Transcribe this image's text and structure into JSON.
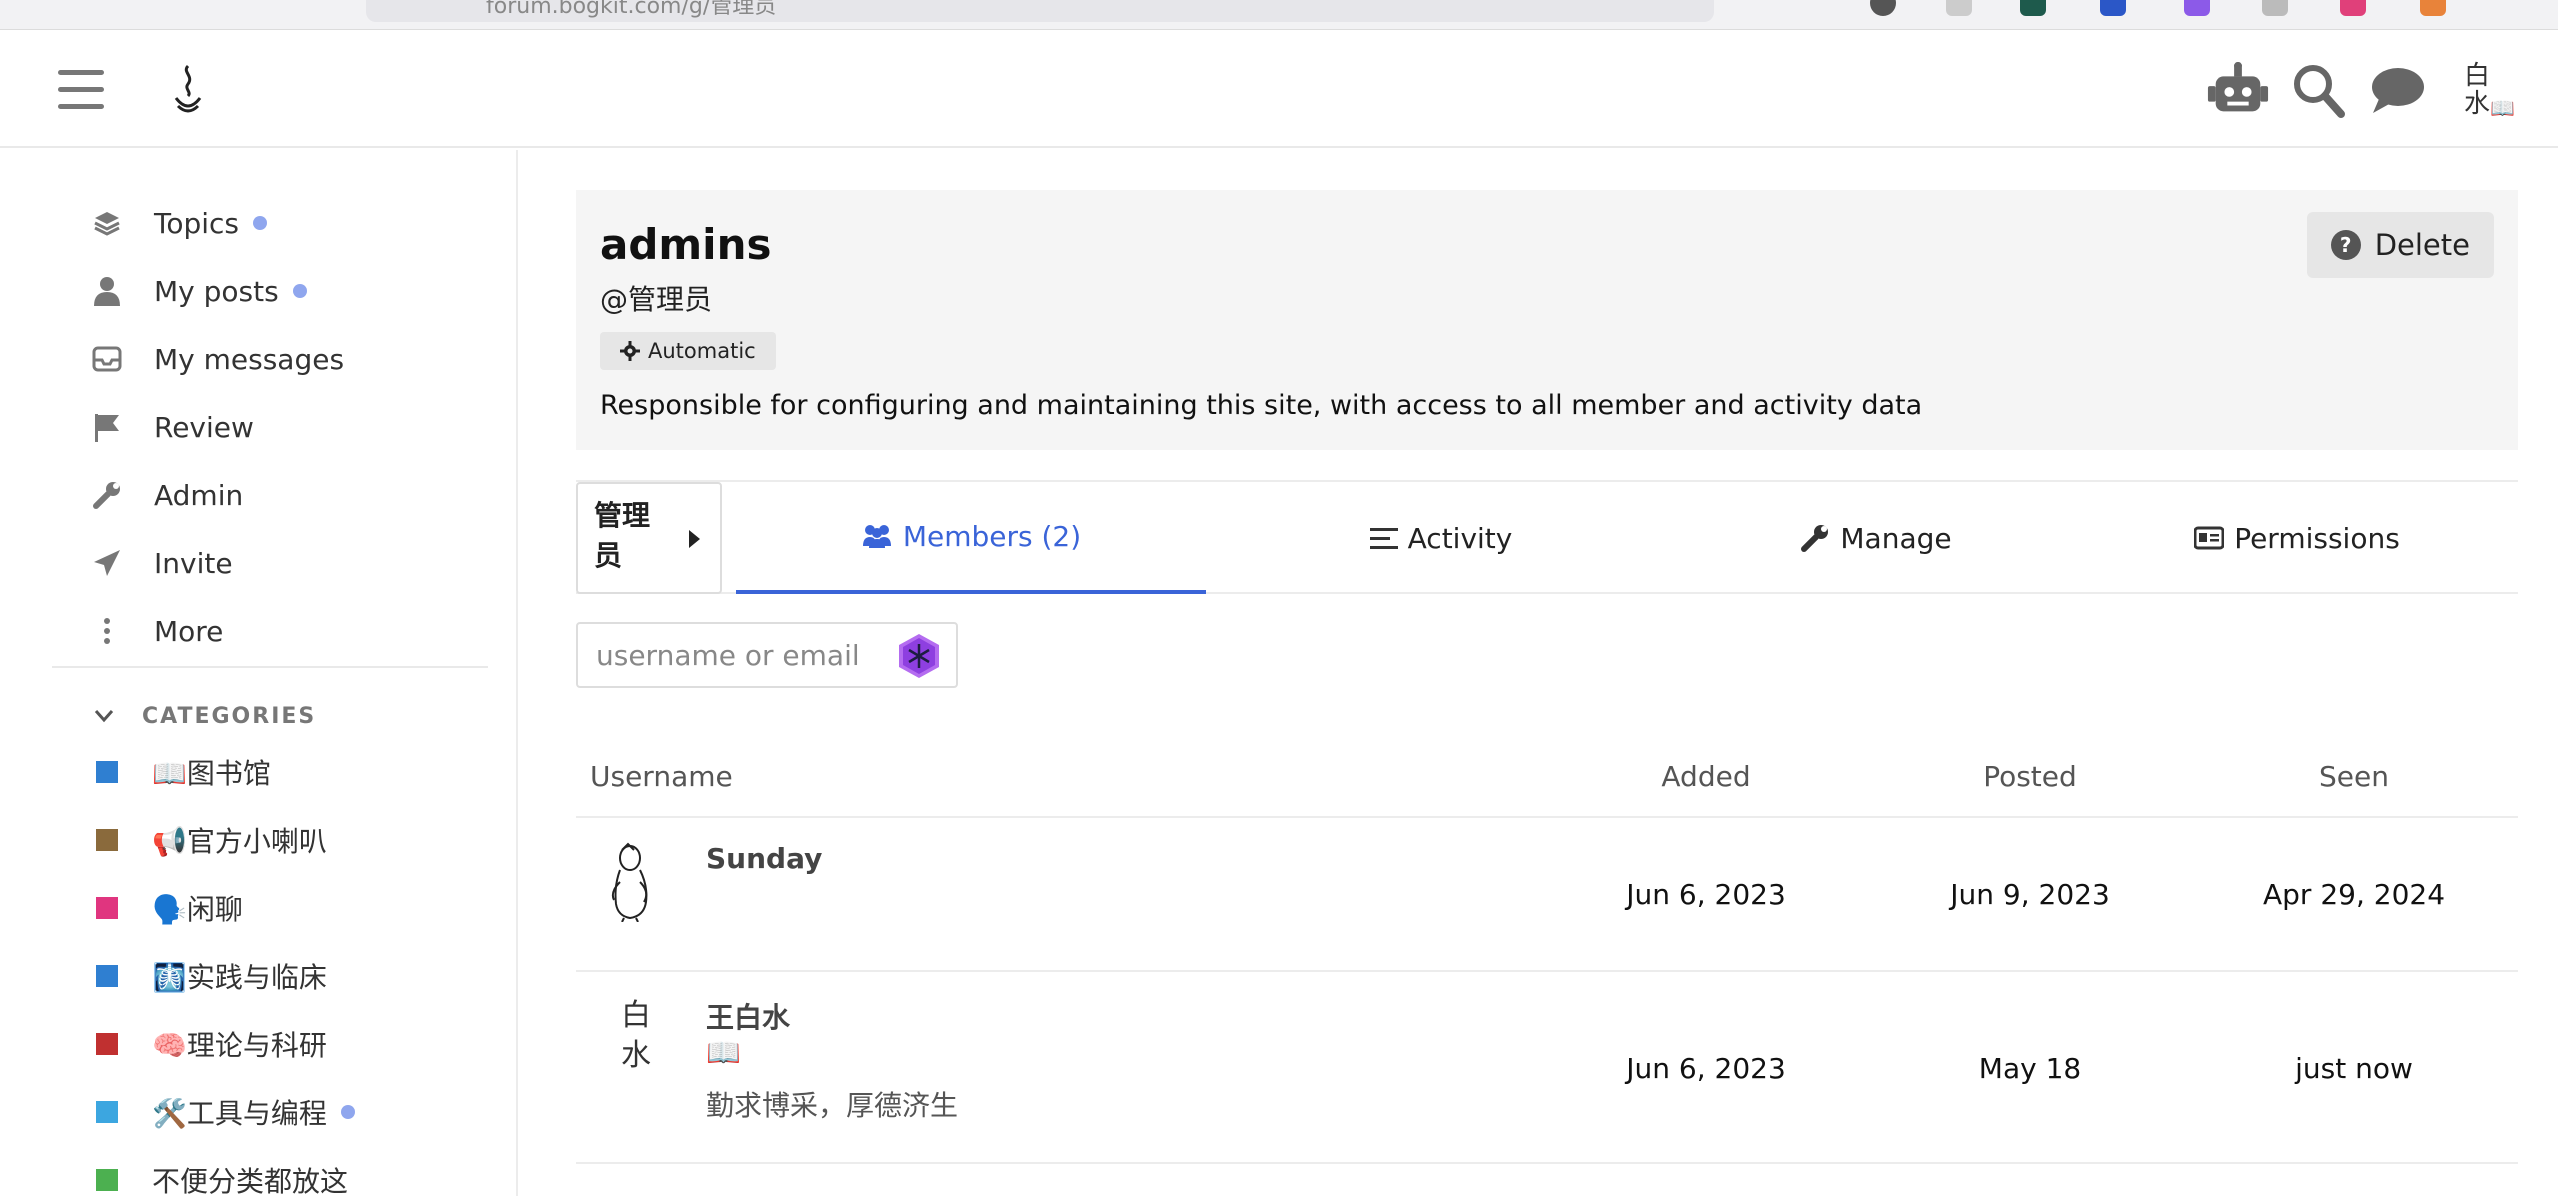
{
  "browser": {
    "url": "forum.bogkit.com/g/管理员"
  },
  "header": {
    "menu_icon": "hamburger-icon",
    "logo_icon": "incense-logo",
    "icons": [
      "robot-icon",
      "search-icon",
      "chat-icon"
    ],
    "avatar_text": "白水📖"
  },
  "sidebar": {
    "nav": [
      {
        "label": "Topics",
        "icon": "layers-icon",
        "unread": true
      },
      {
        "label": "My posts",
        "icon": "user-icon",
        "unread": true
      },
      {
        "label": "My messages",
        "icon": "inbox-icon",
        "unread": false
      },
      {
        "label": "Review",
        "icon": "flag-icon",
        "unread": false
      },
      {
        "label": "Admin",
        "icon": "wrench-icon",
        "unread": false
      },
      {
        "label": "Invite",
        "icon": "paper-plane-icon",
        "unread": false
      },
      {
        "label": "More",
        "icon": "ellipsis-vertical-icon",
        "unread": false
      }
    ],
    "categories_heading": "CATEGORIES",
    "categories": [
      {
        "label": "📖图书馆",
        "color": "#2f7fd1",
        "unread": false
      },
      {
        "label": "📢官方小喇叭",
        "color": "#8a6a3c",
        "unread": false
      },
      {
        "label": "🗣️闲聊",
        "color": "#e0357f",
        "unread": false
      },
      {
        "label": "🩻实践与临床",
        "color": "#2f7fd1",
        "unread": false
      },
      {
        "label": "🧠理论与科研",
        "color": "#c03030",
        "unread": false
      },
      {
        "label": "🛠️工具与编程",
        "color": "#3ca6e0",
        "unread": true
      },
      {
        "label": "不便分类都放这",
        "color": "#4cb050",
        "unread": false
      }
    ]
  },
  "group": {
    "name": "admins",
    "handle": "@管理员",
    "badge": "Automatic",
    "description": "Responsible for configuring and maintaining this site, with access to all member and activity data",
    "delete_label": "Delete"
  },
  "tabs": {
    "group_selector": "管理员",
    "items": [
      {
        "label": "Members (2)",
        "icon": "users-icon",
        "active": true
      },
      {
        "label": "Activity",
        "icon": "list-icon",
        "active": false
      },
      {
        "label": "Manage",
        "icon": "wrench-icon",
        "active": false
      },
      {
        "label": "Permissions",
        "icon": "id-card-icon",
        "active": false
      }
    ]
  },
  "filter": {
    "placeholder": "username or email",
    "ai_icon": "ai-hexagon-icon"
  },
  "table": {
    "headers": {
      "username": "Username",
      "added": "Added",
      "posted": "Posted",
      "seen": "Seen"
    },
    "rows": [
      {
        "username": "Sunday",
        "title": "",
        "avatar": "figure-sketch",
        "added": "Jun 6, 2023",
        "posted": "Jun 9, 2023",
        "seen": "Apr 29, 2024"
      },
      {
        "username": "王白水",
        "title_line1": "📖",
        "title": "勤求博采，厚德济生",
        "avatar": "白水",
        "added": "Jun 6, 2023",
        "posted": "May 18",
        "seen": "just now"
      }
    ]
  }
}
